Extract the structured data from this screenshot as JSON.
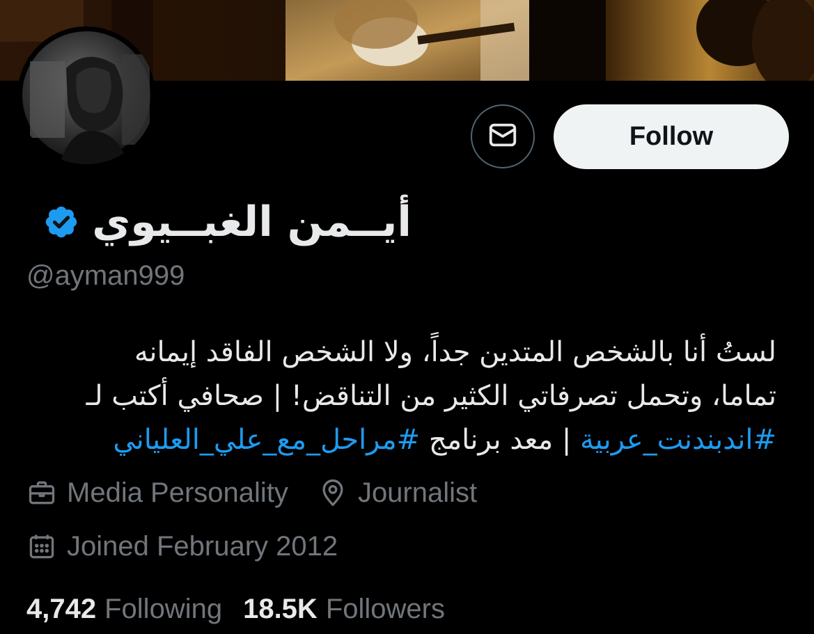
{
  "profile": {
    "display_name": "أيــمن الغبــيوي",
    "handle": "@ayman999",
    "verified": true,
    "follow_label": "Follow",
    "bio_lines": [
      "لستُ أنا بالشخص المتدين جداً، ولا الشخص الفاقد إيمانه",
      "تماما، وتحمل تصرفاتي الكثير من التناقض! | صحافي أكتب لـ"
    ],
    "bio_line3": {
      "hashtag_1": "#اندبندنت_عربية",
      "middle_text": "| معد برنامج",
      "hashtag_2": "#مراحل_مع_علي_العلياني"
    },
    "category": "Media Personality",
    "location": "Journalist",
    "joined": "Joined February 2012",
    "following_count": "4,742",
    "following_label": "Following",
    "followers_count": "18.5K",
    "followers_label": "Followers"
  },
  "icons": {
    "message": "envelope-icon",
    "verified": "verified-badge-icon",
    "category": "briefcase-icon",
    "location": "location-pin-icon",
    "joined": "calendar-icon"
  },
  "colors": {
    "background": "#000000",
    "text": "#e7e9ea",
    "secondary_text": "#71767b",
    "link": "#1d9bf0",
    "verified_badge": "#1d9bf0",
    "follow_button_bg": "#eff3f4"
  }
}
